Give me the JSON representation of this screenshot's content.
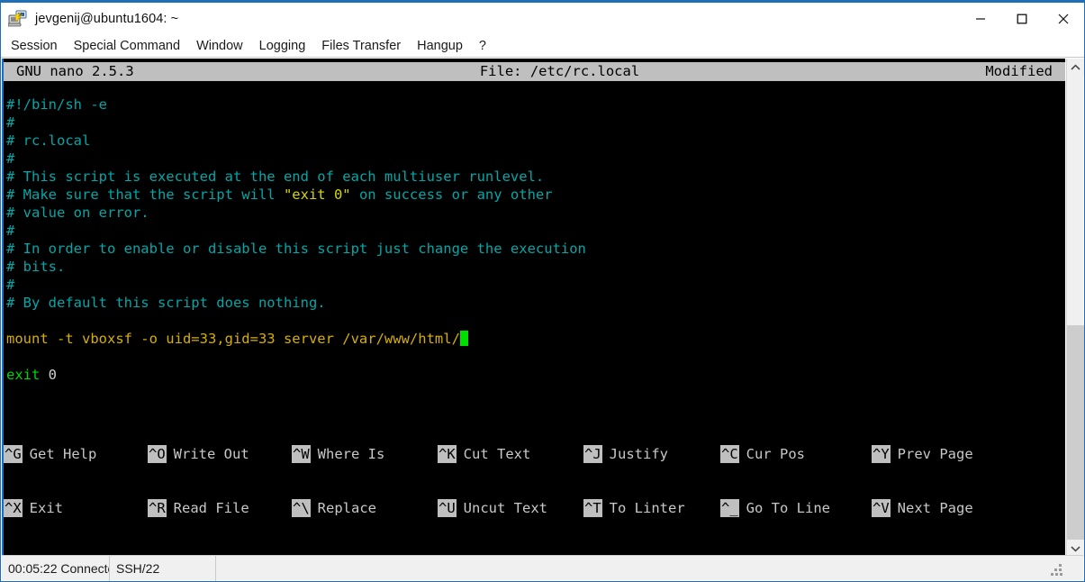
{
  "window": {
    "title": "jevgenij@ubuntu1604: ~",
    "icon": "terminal-session-icon",
    "controls": {
      "minimize": "minimize-icon",
      "maximize": "maximize-icon",
      "close": "close-icon"
    }
  },
  "menubar": {
    "items": [
      {
        "label": "Session"
      },
      {
        "label": "Special Command"
      },
      {
        "label": "Window"
      },
      {
        "label": "Logging"
      },
      {
        "label": "Files Transfer"
      },
      {
        "label": "Hangup"
      },
      {
        "label": "?"
      }
    ]
  },
  "nano": {
    "version_label": "GNU nano 2.5.3",
    "file_label": "File: /etc/rc.local",
    "modified_label": "Modified",
    "lines": [
      {
        "segments": [
          {
            "text": "#!/bin/sh -e",
            "color": "cmt"
          }
        ]
      },
      {
        "segments": [
          {
            "text": "#",
            "color": "cmt"
          }
        ]
      },
      {
        "segments": [
          {
            "text": "# rc.local",
            "color": "cmt"
          }
        ]
      },
      {
        "segments": [
          {
            "text": "#",
            "color": "cmt"
          }
        ]
      },
      {
        "segments": [
          {
            "text": "# This script is executed at the end of each multiuser runlevel.",
            "color": "cmt"
          }
        ]
      },
      {
        "segments": [
          {
            "text": "# Make sure that the script will ",
            "color": "cmt"
          },
          {
            "text": "\"exit 0\"",
            "color": "str"
          },
          {
            "text": " on success or any other",
            "color": "cmt"
          }
        ]
      },
      {
        "segments": [
          {
            "text": "# value on error.",
            "color": "cmt"
          }
        ]
      },
      {
        "segments": [
          {
            "text": "#",
            "color": "cmt"
          }
        ]
      },
      {
        "segments": [
          {
            "text": "# In order to enable or disable this script just change the execution",
            "color": "cmt"
          }
        ]
      },
      {
        "segments": [
          {
            "text": "# bits.",
            "color": "cmt"
          }
        ]
      },
      {
        "segments": [
          {
            "text": "#",
            "color": "cmt"
          }
        ]
      },
      {
        "segments": [
          {
            "text": "# By default this script does nothing.",
            "color": "cmt"
          }
        ]
      },
      {
        "segments": [
          {
            "text": "",
            "color": "wht"
          }
        ]
      },
      {
        "segments": [
          {
            "text": "mount -t vboxsf -o uid=33,gid=33 server /var/www/html/",
            "color": "cmd"
          },
          {
            "text": "",
            "color": "cursor"
          }
        ]
      },
      {
        "segments": [
          {
            "text": "",
            "color": "wht"
          }
        ]
      },
      {
        "segments": [
          {
            "text": "exit",
            "color": "grn"
          },
          {
            "text": " 0",
            "color": "wht"
          }
        ]
      }
    ],
    "shortcuts_row1": [
      {
        "key": "^G",
        "label": "Get Help"
      },
      {
        "key": "^O",
        "label": "Write Out"
      },
      {
        "key": "^W",
        "label": "Where Is"
      },
      {
        "key": "^K",
        "label": "Cut Text"
      },
      {
        "key": "^J",
        "label": "Justify"
      },
      {
        "key": "^C",
        "label": "Cur Pos"
      },
      {
        "key": "^Y",
        "label": "Prev Page"
      }
    ],
    "shortcuts_row2": [
      {
        "key": "^X",
        "label": "Exit"
      },
      {
        "key": "^R",
        "label": "Read File"
      },
      {
        "key": "^\\",
        "label": "Replace"
      },
      {
        "key": "^U",
        "label": "Uncut Text"
      },
      {
        "key": "^T",
        "label": "To Linter"
      },
      {
        "key": "^_",
        "label": "Go To Line"
      },
      {
        "key": "^V",
        "label": "Next Page"
      }
    ]
  },
  "scrollbar": {
    "up_arrow": "chevron-up-icon",
    "down_arrow": "chevron-down-icon"
  },
  "statusbar": {
    "time": "00:05:22 Connecte",
    "protocol": "SSH/22",
    "blank": ""
  },
  "colors": {
    "accent": "#1e6fb8",
    "terminal_bg": "#000000",
    "comment": "#00a8a8",
    "string": "#d7d700",
    "command": "#d7af00",
    "green": "#00d700",
    "cursor": "#00e000",
    "nano_bar_bg": "#bfbfbf"
  }
}
